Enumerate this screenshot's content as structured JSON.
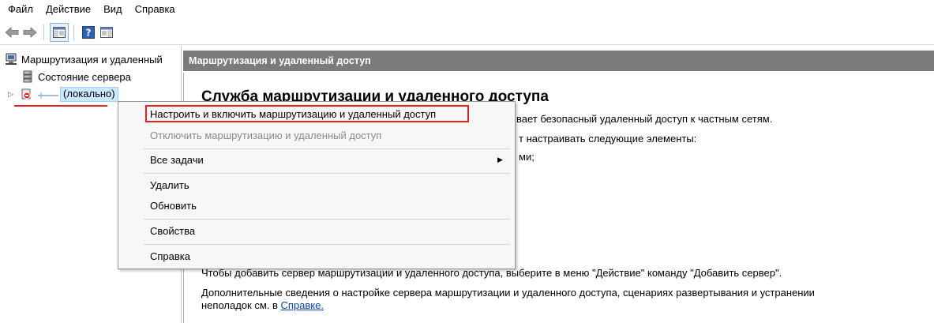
{
  "menubar": {
    "items": [
      "Файл",
      "Действие",
      "Вид",
      "Справка"
    ]
  },
  "toolbar": {
    "icons": [
      "back-arrow-icon",
      "forward-arrow-icon",
      "console-tree-icon",
      "help-icon",
      "action-pane-icon"
    ]
  },
  "tree": {
    "root_label": "Маршрутизация и удаленный",
    "server_status_label": "Состояние сервера",
    "local_label": "(локально)"
  },
  "right": {
    "header": "Маршрутизация и удаленный доступ",
    "title": "Служба маршрутизации и удаленного доступа",
    "line1": "вает безопасный удаленный доступ к частным сетям.",
    "line2": "т настраивать следующие элементы:",
    "line3": "ми;",
    "add_server_text": "Чтобы добавить сервер маршрутизации и удаленного доступа, выберите в меню \"Действие\" команду \"Добавить сервер\".",
    "more_info_line1": "Дополнительные сведения о настройке сервера маршрутизации и удаленного доступа, сценариях развертывания и устранении",
    "more_info_line2": "неполадок см. в",
    "help_link": "Справке."
  },
  "context_menu": {
    "configure": "Настроить и включить маршрутизацию и удаленный доступ",
    "disable": "Отключить маршрутизацию и удаленный доступ",
    "all_tasks": "Все задачи",
    "delete": "Удалить",
    "refresh": "Обновить",
    "properties": "Свойства",
    "help": "Справка"
  },
  "colors": {
    "header_bg": "#7b7b7b",
    "highlight": "#e52020",
    "selection": "#cce8ff",
    "disabled_text": "#8a8a8a",
    "link": "#0645ad"
  }
}
